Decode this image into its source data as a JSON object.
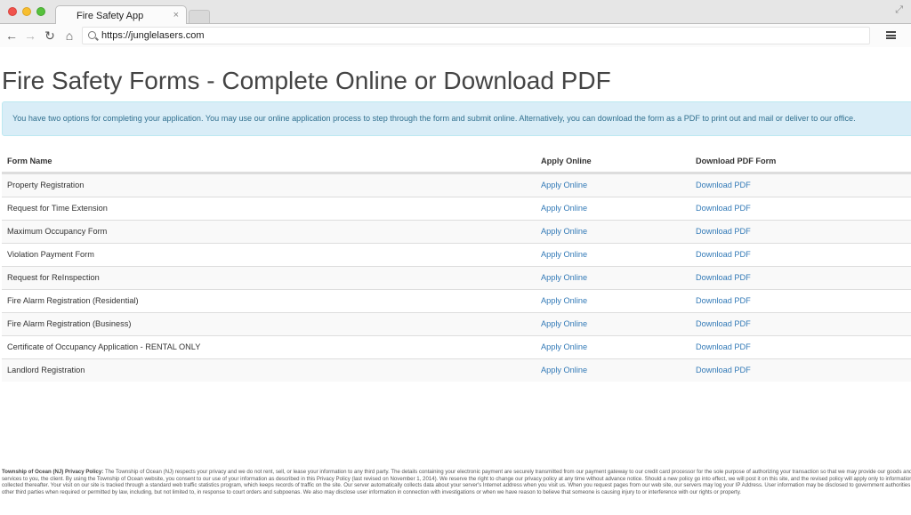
{
  "browser": {
    "tab_title": "Fire Safety App",
    "tab_close": "×",
    "url": "https://junglelasers.com"
  },
  "page": {
    "title": "Fire Safety Forms - Complete Online or Download PDF",
    "alert": "You have two options for completing your application. You may use our online application process to step through the form and submit online. Alternatively, you can download the form as a PDF to print out and mail or deliver to our office.",
    "table": {
      "headers": [
        "Form Name",
        "Apply Online",
        "Download PDF Form"
      ],
      "rows": [
        {
          "name": "Property Registration",
          "apply": "Apply Online",
          "download": "Download PDF"
        },
        {
          "name": "Request for Time Extension",
          "apply": "Apply Online",
          "download": "Download PDF"
        },
        {
          "name": "Maximum Occupancy Form",
          "apply": "Apply Online",
          "download": "Download PDF"
        },
        {
          "name": "Violation Payment Form",
          "apply": "Apply Online",
          "download": "Download PDF"
        },
        {
          "name": "Request for ReInspection",
          "apply": "Apply Online",
          "download": "Download PDF"
        },
        {
          "name": "Fire Alarm Registration (Residential)",
          "apply": "Apply Online",
          "download": "Download PDF"
        },
        {
          "name": "Fire Alarm Registration (Business)",
          "apply": "Apply Online",
          "download": "Download PDF"
        },
        {
          "name": "Certificate of Occupancy Application - RENTAL ONLY",
          "apply": "Apply Online",
          "download": "Download PDF"
        },
        {
          "name": "Landlord Registration",
          "apply": "Apply Online",
          "download": "Download PDF"
        }
      ]
    },
    "footer": {
      "heading": "Township of Ocean (NJ) Privacy Policy:",
      "text": "The Township of Ocean (NJ) respects your privacy and we do not rent, sell, or lease your information to any third party. The details containing your electronic payment are securely transmitted from our payment gateway to our credit card processor for the sole purpose of authorizing your transaction so that we may provide our goods and services to you, the client. By using the Township of Ocean website, you consent to our use of your information as described in this Privacy Policy (last revised on November 1, 2014). We reserve the right to change our privacy policy at any time without advance notice. Should a new policy go into effect, we will post it on this site, and the revised policy will apply only to information collected thereafter. Your visit on our site is tracked through a standard web traffic statistics program, which keeps records of traffic on the site. Our server automatically collects data about your server's Internet address when you visit us. When you request pages from our web site, our servers may log your IP Address. User information may be disclosed to government authorities or other third parties when required or permitted by law, including, but not limited to, in response to court orders and subpoenas. We also may disclose user information in connection with investigations or when we have reason to believe that someone is causing injury to or interference with our rights or property."
    }
  }
}
